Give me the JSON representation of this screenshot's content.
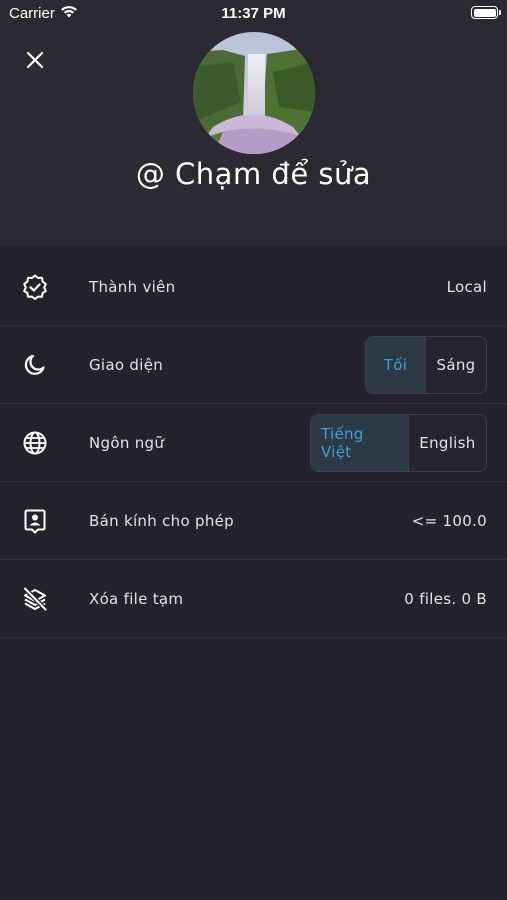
{
  "status_bar": {
    "carrier": "Carrier",
    "time": "11:37 PM"
  },
  "header": {
    "profile_name": "@ Chạm để sửa"
  },
  "settings": {
    "membership": {
      "label": "Thành viên",
      "value": "Local"
    },
    "theme": {
      "label": "Giao diện",
      "options": [
        "Tối",
        "Sáng"
      ],
      "selected": "Tối"
    },
    "language": {
      "label": "Ngôn ngữ",
      "options": [
        "Tiếng Việt",
        "English"
      ],
      "selected": "Tiếng Việt"
    },
    "radius": {
      "label": "Bán kính cho phép",
      "value": "<= 100.0"
    },
    "clear_temp": {
      "label": "Xóa file tạm",
      "value": "0 files. 0 B"
    }
  },
  "colors": {
    "background": "#24232d",
    "header": "#2b2a34",
    "accent": "#3fa0cf",
    "segment_active_bg": "#2c3a45"
  },
  "icons": [
    "wifi-icon",
    "battery-icon",
    "close-icon",
    "verified-badge-icon",
    "moon-icon",
    "globe-icon",
    "id-badge-icon",
    "layers-off-icon"
  ]
}
